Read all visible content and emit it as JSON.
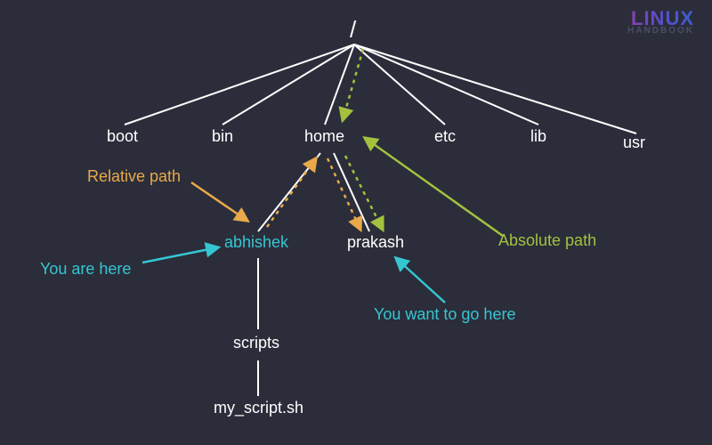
{
  "logo": {
    "main": "LINUX",
    "sub": "HANDBOOK"
  },
  "root": "/",
  "dirs": {
    "boot": "boot",
    "bin": "bin",
    "home": "home",
    "etc": "etc",
    "lib": "lib",
    "usr": "usr",
    "abhishek": "abhishek",
    "prakash": "prakash",
    "scripts": "scripts",
    "my_script": "my_script.sh"
  },
  "annotations": {
    "relative_path": "Relative path",
    "you_are_here": "You are here",
    "you_want_go": "You want to go here",
    "absolute_path": "Absolute path"
  },
  "colors": {
    "bg": "#2b2d3a",
    "white": "#ffffff",
    "cyan": "#35c6d2",
    "orange": "#e8a94a",
    "green": "#a3c13f"
  }
}
